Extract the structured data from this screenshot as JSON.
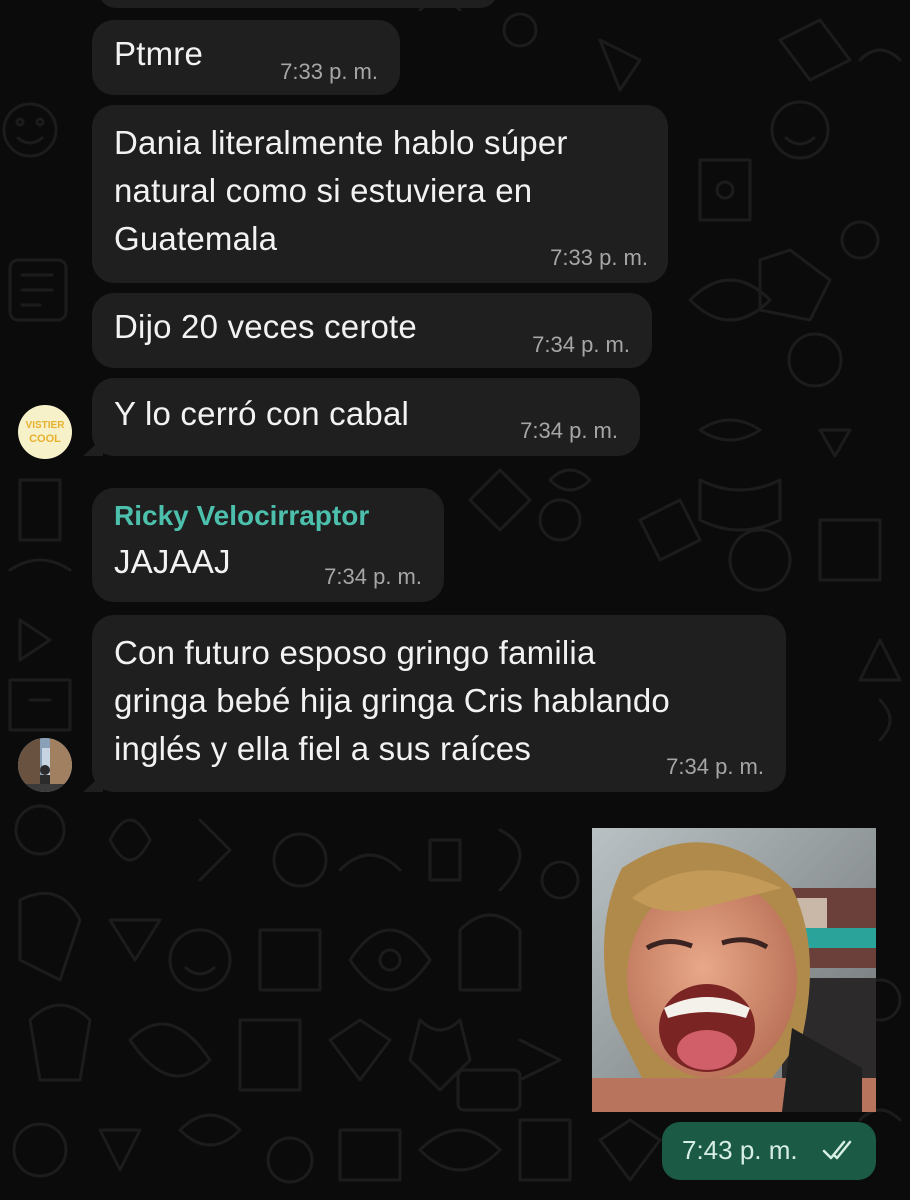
{
  "messages": [
    {
      "text": "Ptmre",
      "time": "7:33 p. m."
    },
    {
      "text": "Dania literalmente hablo súper natural como si estuviera en Guatemala",
      "lines": [
        "Dania literalmente hablo súper",
        "natural como si estuviera en",
        "Guatemala"
      ],
      "time": "7:33 p. m."
    },
    {
      "text": "Dijo 20 veces cerote",
      "time": "7:34 p. m."
    },
    {
      "text": "Y lo cerró con cabal",
      "time": "7:34 p. m."
    },
    {
      "sender": "Ricky Velocirraptor",
      "text": "JAJAAJ",
      "time": "7:34 p. m."
    },
    {
      "text": "Con futuro esposo gringo familia gringa bebé hija gringa Cris hablando inglés y ella fiel a sus raíces",
      "lines": [
        "Con futuro esposo gringo familia",
        "gringa bebé hija gringa Cris hablando",
        "inglés y ella fiel a sus raíces"
      ],
      "time": "7:34 p. m."
    }
  ],
  "avatars": [
    {
      "name": "sticker-avatar",
      "text": [
        "VISTIER",
        "COOL"
      ]
    },
    {
      "name": "photo-avatar"
    }
  ],
  "outgoing": {
    "time": "7:43 p. m.",
    "status_icon": "double-check-icon",
    "media": "photo-message"
  },
  "colors": {
    "background": "#0b0b0b",
    "incoming_bubble": "#1f1f1f",
    "outgoing_bubble": "#1b5a44",
    "sender_name": "#4cc0ad",
    "timestamp": "#a6a6a6",
    "read_check": "#d7eee4"
  }
}
